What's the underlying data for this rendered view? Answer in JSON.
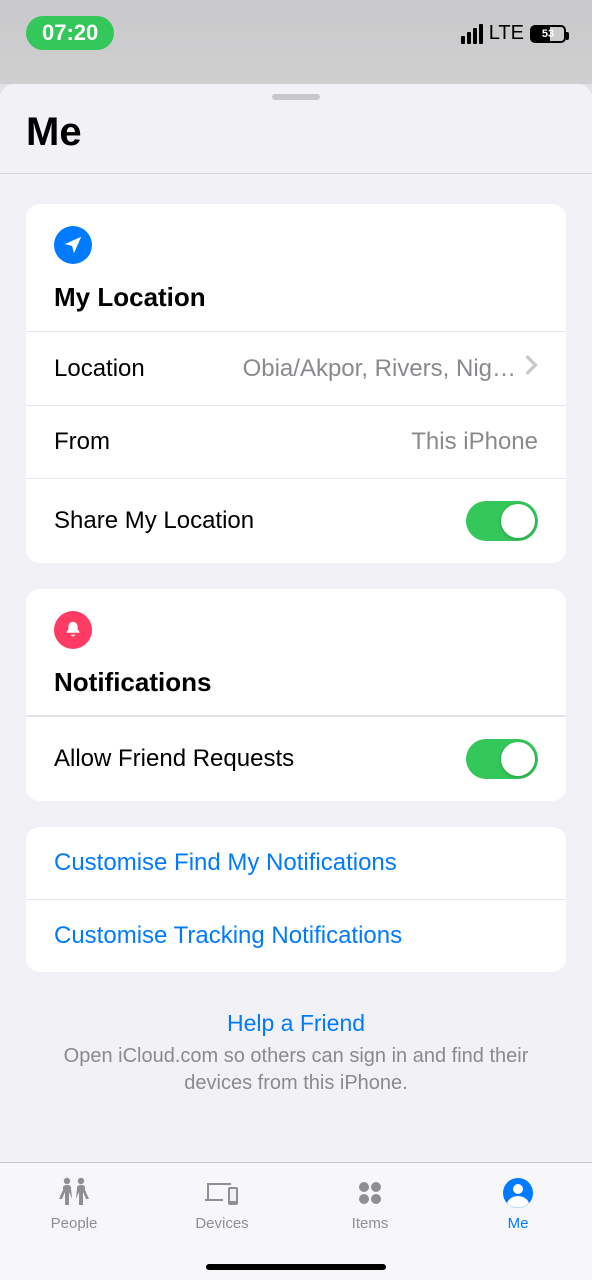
{
  "status": {
    "time": "07:20",
    "network": "LTE",
    "battery_percent": "53"
  },
  "sheet": {
    "title": "Me"
  },
  "location_section": {
    "header": "My Location",
    "rows": {
      "location": {
        "label": "Location",
        "value": "Obia/Akpor, Rivers, Nig…"
      },
      "from": {
        "label": "From",
        "value": "This iPhone"
      },
      "share": {
        "label": "Share My Location",
        "on": true
      }
    }
  },
  "notifications_section": {
    "header": "Notifications",
    "rows": {
      "friend_requests": {
        "label": "Allow Friend Requests",
        "on": true
      }
    }
  },
  "links_section": {
    "customise_findmy": "Customise Find My Notifications",
    "customise_tracking": "Customise Tracking Notifications"
  },
  "help": {
    "title": "Help a Friend",
    "text": "Open iCloud.com so others can sign in and find their devices from this iPhone."
  },
  "tabs": {
    "people": "People",
    "devices": "Devices",
    "items": "Items",
    "me": "Me"
  }
}
